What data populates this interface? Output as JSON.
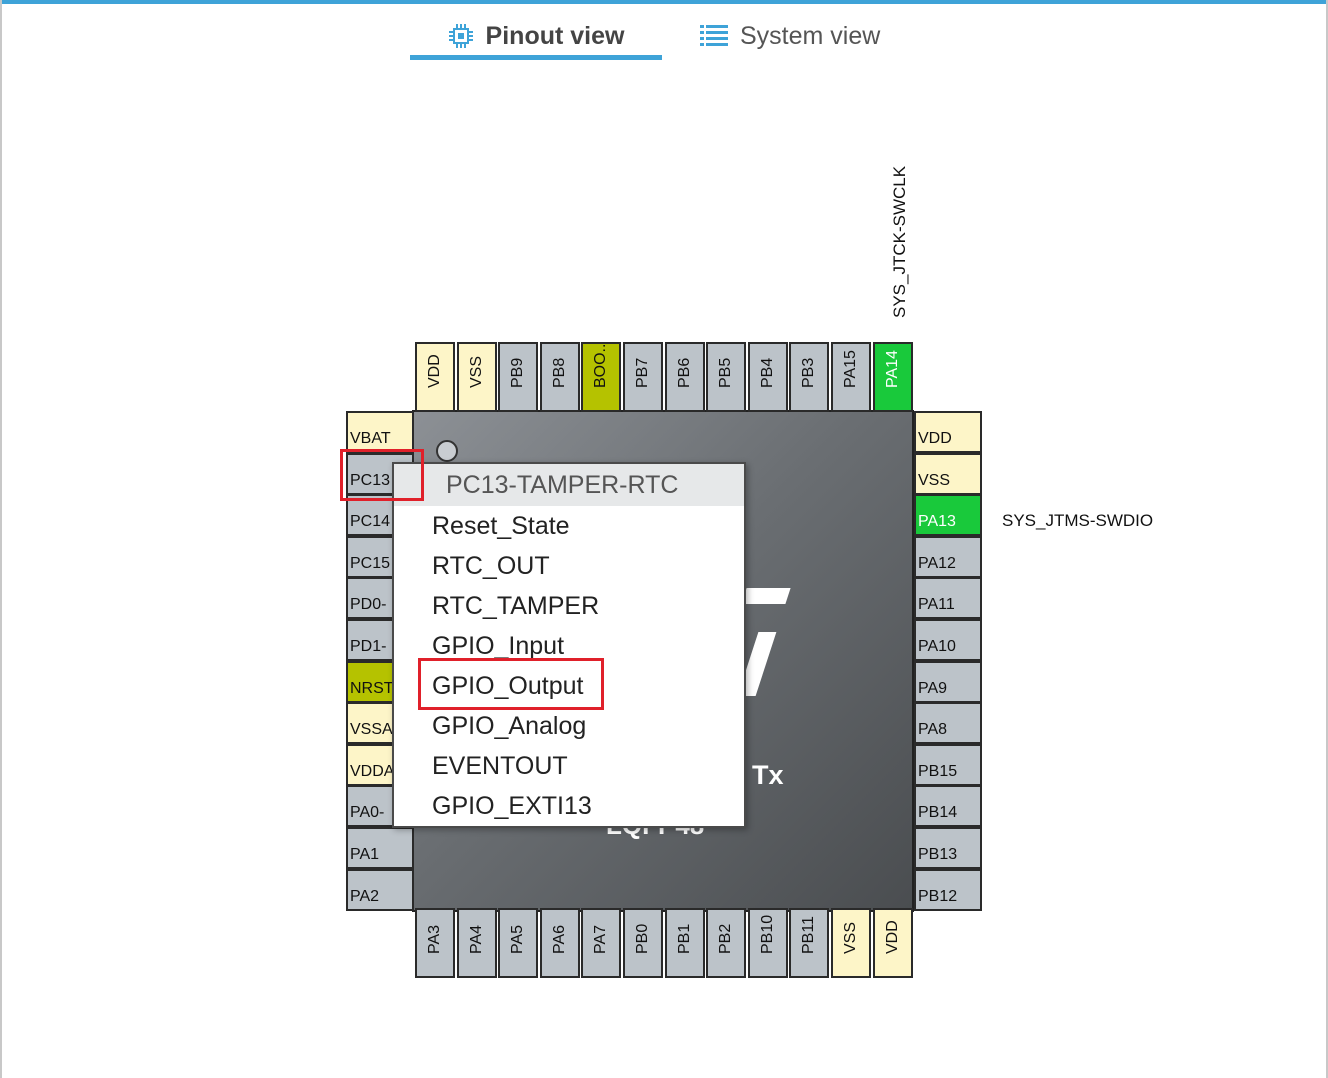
{
  "tabs": {
    "pinout_label": "Pinout view",
    "system_label": "System view",
    "active": "pinout"
  },
  "pins": {
    "top": [
      "VDD",
      "VSS",
      "PB9",
      "PB8",
      "BOO..",
      "PB7",
      "PB6",
      "PB5",
      "PB4",
      "PB3",
      "PA15",
      "PA14"
    ],
    "bottom": [
      "PA3",
      "PA4",
      "PA5",
      "PA6",
      "PA7",
      "PB0",
      "PB1",
      "PB2",
      "PB10",
      "PB11",
      "VSS",
      "VDD"
    ],
    "left": [
      "VBAT",
      "PC13",
      "PC14",
      "PC15",
      "PD0-",
      "PD1-",
      "NRST",
      "VSSA",
      "VDDA",
      "PA0-",
      "PA1",
      "PA2"
    ],
    "right": [
      "VDD",
      "VSS",
      "PA13",
      "PA12",
      "PA11",
      "PA10",
      "PA9",
      "PA8",
      "PB15",
      "PB14",
      "PB13",
      "PB12"
    ]
  },
  "signals": {
    "pa14": "SYS_JTCK-SWCLK",
    "pa13": "SYS_JTMS-SWDIO"
  },
  "chip": {
    "text_partial_1": "Tx",
    "text_partial_2": "LQFP48"
  },
  "context_menu": {
    "header": "PC13-TAMPER-RTC",
    "items": [
      "Reset_State",
      "RTC_OUT",
      "RTC_TAMPER",
      "GPIO_Input",
      "GPIO_Output",
      "GPIO_Analog",
      "EVENTOUT",
      "GPIO_EXTI13"
    ],
    "highlighted_item": "GPIO_Output"
  },
  "colors": {
    "accent": "#3ea3d8",
    "pin_default": "#bcc3c9",
    "pin_power": "#fdf5c8",
    "pin_reset_boot": "#b5c200",
    "pin_assigned": "#19c93b",
    "highlight_box": "#e0202a"
  }
}
